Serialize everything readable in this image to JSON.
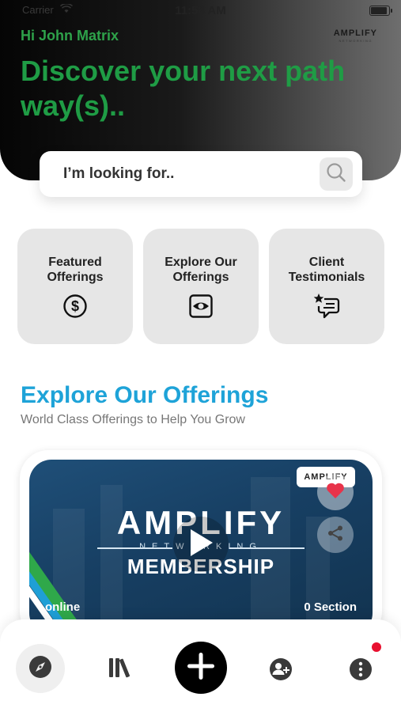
{
  "status_bar": {
    "time": "11:58 AM",
    "carrier": "Carrier"
  },
  "header": {
    "greeting": "Hi John Matrix",
    "brand": "AMPLIFY",
    "brand_sub": "NETWORKING",
    "headline": "Discover your next path way(s).."
  },
  "search": {
    "placeholder": "I’m looking for..",
    "icon": "search-icon"
  },
  "tiles": [
    {
      "label": "Featured Offerings",
      "icon": "dollar-coin-icon"
    },
    {
      "label": "Explore Our Offerings",
      "icon": "eye-icon"
    },
    {
      "label": "Client Testimonials",
      "icon": "testimonial-chat-icon"
    }
  ],
  "section": {
    "title": "Explore Our Offerings",
    "subtitle": "World Class Offerings to Help You Grow"
  },
  "offering_card": {
    "media_title": "AMPLIFY",
    "media_subtitle": "NETWORKING",
    "media_membership": "MEMBERSHIP",
    "logo": "AMPLIFY",
    "mode": "online",
    "sections": "0 Section",
    "favorite_color": "#e8334a"
  },
  "bottom_nav": {
    "items": [
      {
        "name": "explore",
        "icon": "compass-icon"
      },
      {
        "name": "library",
        "icon": "library-icon"
      },
      {
        "name": "add",
        "icon": "plus-icon"
      },
      {
        "name": "invite",
        "icon": "add-person-icon"
      },
      {
        "name": "more",
        "icon": "more-vertical-icon"
      }
    ],
    "has_notification": true
  },
  "colors": {
    "accent_green": "#1f9c45",
    "accent_blue": "#1ea3d8",
    "notification_red": "#e8102f"
  }
}
